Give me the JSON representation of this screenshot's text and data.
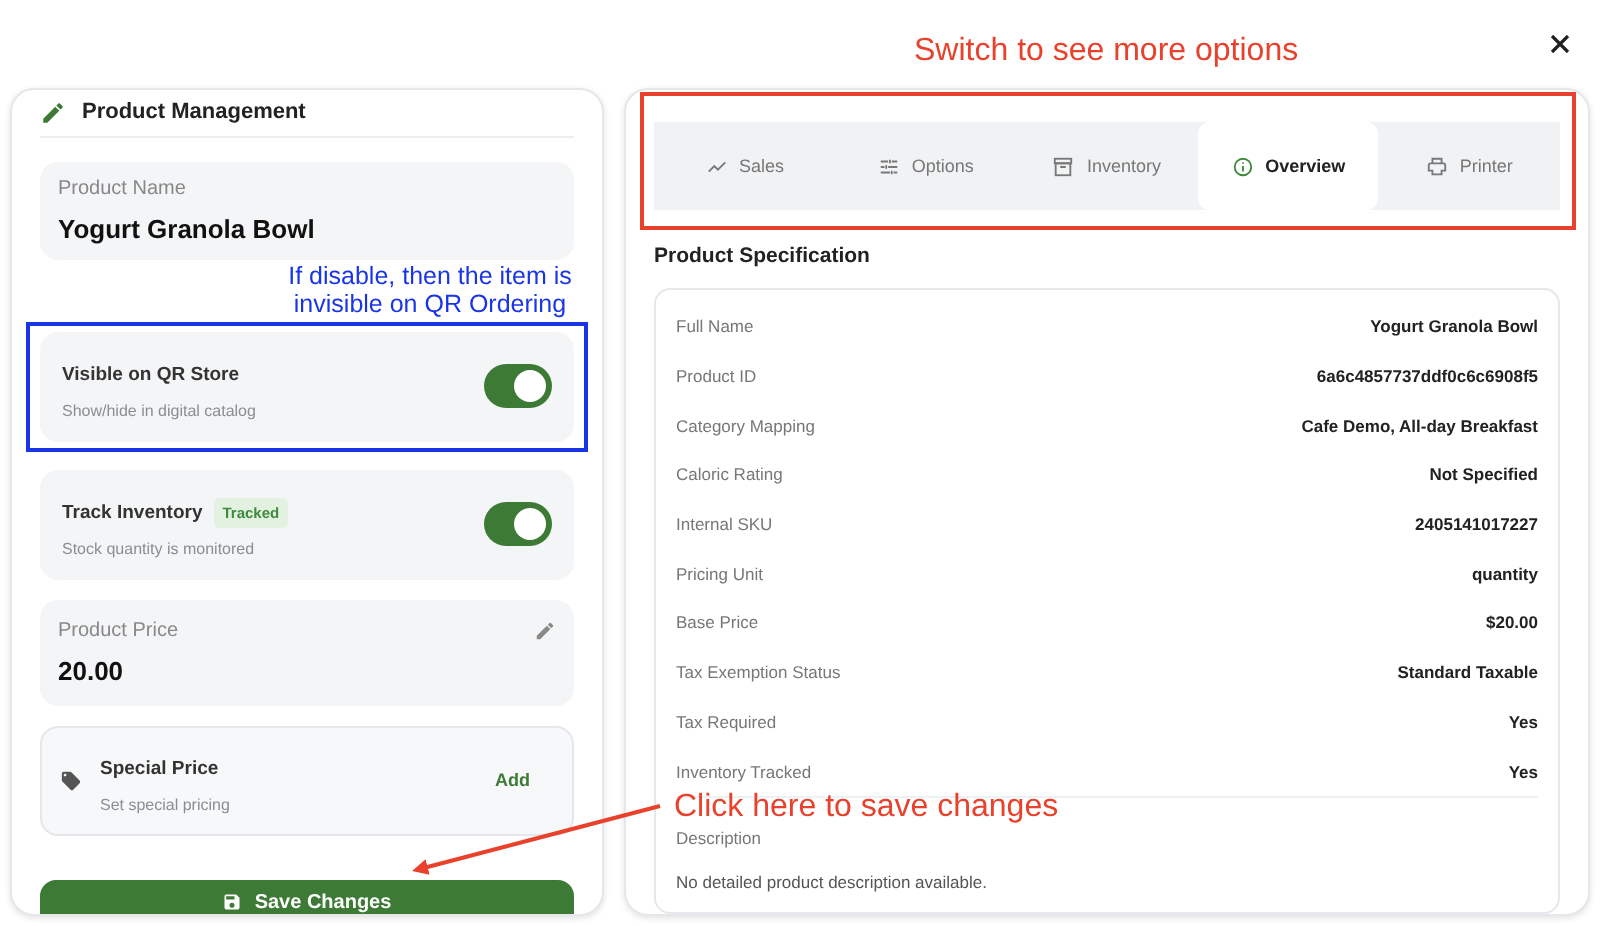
{
  "product_management": {
    "title": "Product Management",
    "product_name": {
      "label": "Product Name",
      "value": "Yogurt Granola Bowl"
    },
    "toggles": [
      {
        "title": "Visible on QR Store",
        "subtitle": "Show/hide in digital catalog",
        "on": true
      },
      {
        "title": "Track Inventory",
        "badge": "Tracked",
        "subtitle": "Stock quantity is monitored",
        "on": true
      }
    ],
    "price": {
      "label": "Product Price",
      "value": "20.00"
    },
    "special_price": {
      "title": "Special Price",
      "subtitle": "Set special pricing",
      "action": "Add"
    },
    "save_button": "Save Changes"
  },
  "tabs": [
    {
      "label": "Sales",
      "selected": false
    },
    {
      "label": "Options",
      "selected": false
    },
    {
      "label": "Inventory",
      "selected": false
    },
    {
      "label": "Overview",
      "selected": true
    },
    {
      "label": "Printer",
      "selected": false
    }
  ],
  "specification": {
    "title": "Product Specification",
    "rows": [
      {
        "label": "Full Name",
        "value": "Yogurt Granola Bowl"
      },
      {
        "label": "Product ID",
        "value": "6a6c4857737ddf0c6c6908f5"
      },
      {
        "label": "Category Mapping",
        "value": "Cafe Demo, All-day Breakfast"
      },
      {
        "label": "Caloric Rating",
        "value": "Not Specified"
      },
      {
        "label": "Internal SKU",
        "value": "2405141017227"
      },
      {
        "label": "Pricing Unit",
        "value": "quantity"
      },
      {
        "label": "Base Price",
        "value": "$20.00"
      },
      {
        "label": "Tax Exemption Status",
        "value": "Standard Taxable"
      },
      {
        "label": "Tax Required",
        "value": "Yes"
      },
      {
        "label": "Inventory Tracked",
        "value": "Yes"
      }
    ],
    "description": {
      "label": "Description",
      "text": "No detailed product description available."
    }
  },
  "annotations": {
    "tabs_note": "Switch to see more options",
    "visibility_note": "If disable, then the item is invisible on QR Ordering",
    "save_note": "Click here to save changes"
  }
}
